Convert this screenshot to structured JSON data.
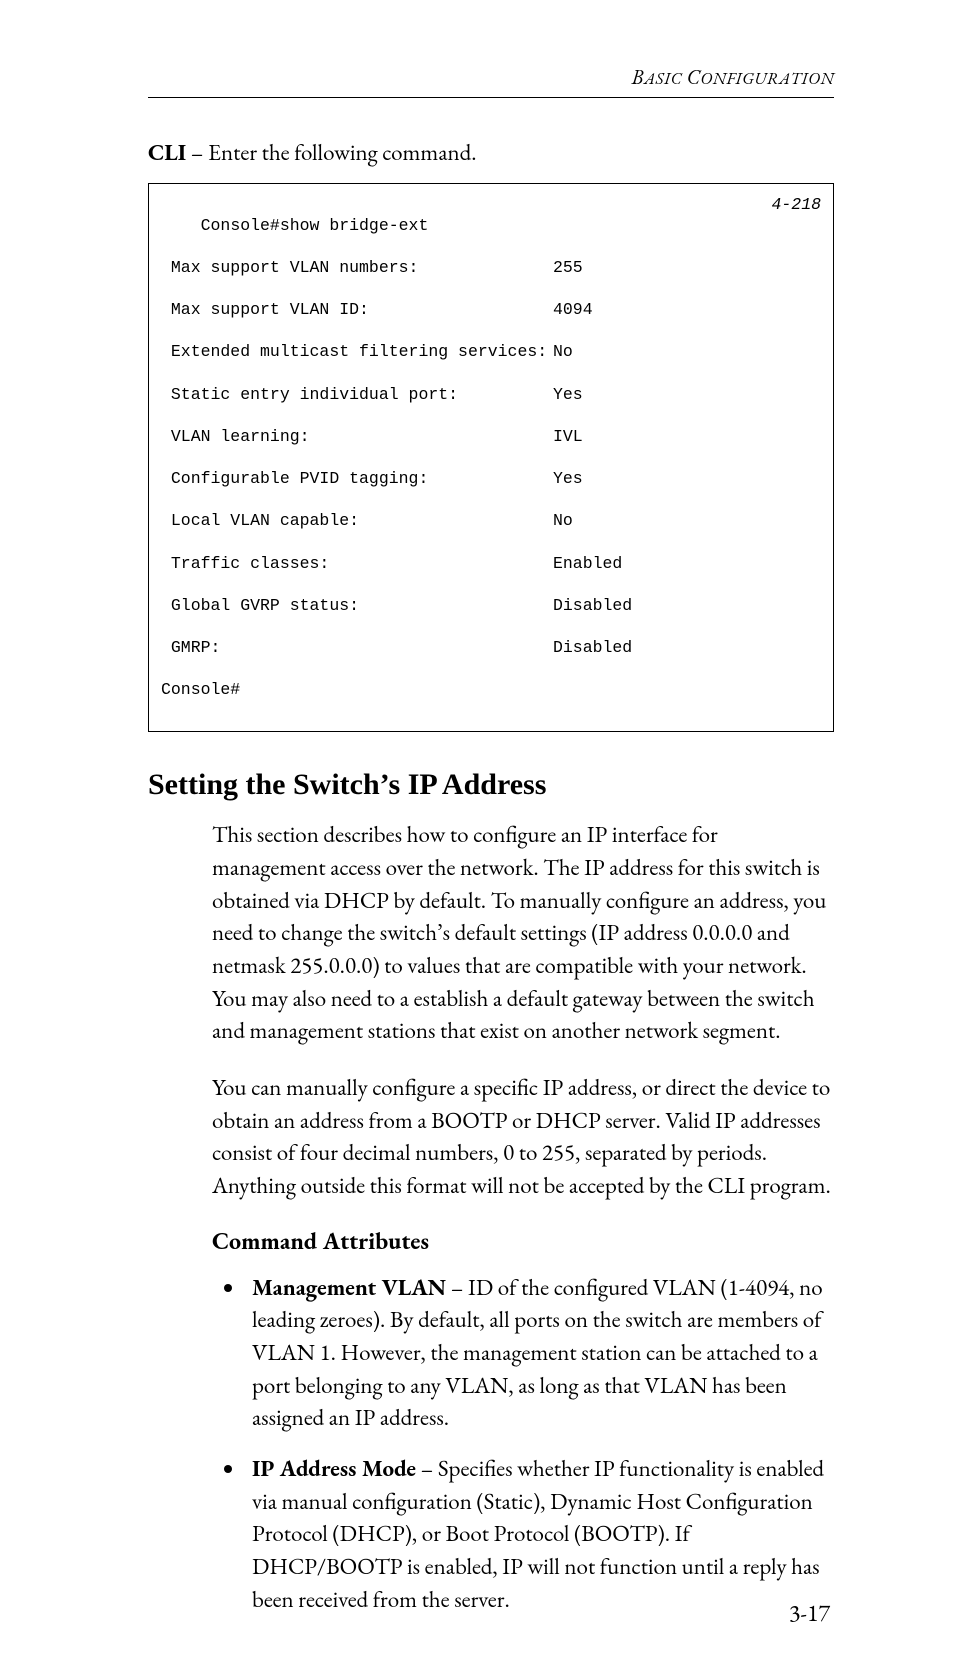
{
  "running_head": "BASIC CONFIGURATION",
  "lead_sentence_prefix": "CLI",
  "lead_sentence_rest": " – Enter the following command.",
  "console": {
    "cmd": "Console#show bridge-ext",
    "ref": "4-218",
    "rows": [
      {
        "k": " Max support VLAN numbers:",
        "v": "255"
      },
      {
        "k": " Max support VLAN ID:",
        "v": "4094"
      },
      {
        "k": " Extended multicast filtering services:",
        "v": "No"
      },
      {
        "k": " Static entry individual port:",
        "v": "Yes"
      },
      {
        "k": " VLAN learning:",
        "v": "IVL"
      },
      {
        "k": " Configurable PVID tagging:",
        "v": "Yes"
      },
      {
        "k": " Local VLAN capable:",
        "v": "No"
      },
      {
        "k": " Traffic classes:",
        "v": "Enabled"
      },
      {
        "k": " Global GVRP status:",
        "v": "Disabled"
      },
      {
        "k": " GMRP:",
        "v": "Disabled"
      }
    ],
    "prompt": "Console#"
  },
  "section_title": "Setting the Switch’s IP Address",
  "para1": "This section describes how to configure an IP interface for management access over the network. The IP address for this switch is obtained via DHCP by default. To manually configure an address, you need to change the switch’s default settings (IP address 0.0.0.0 and netmask 255.0.0.0) to values that are compatible with your network. You may also need to a establish a default gateway between the switch and management stations that exist on another network segment.",
  "para2": "You can manually configure a specific IP address, or direct the device to obtain an address from a BOOTP or DHCP server. Valid IP addresses consist of four decimal numbers, 0 to 255, separated by periods. Anything outside this format will not be accepted by the CLI program.",
  "subhead": "Command Attributes",
  "bullets": [
    {
      "term": "Management VLAN",
      "rest": " – ID of the configured VLAN (1-4094, no leading zeroes). By default, all ports on the switch are members of VLAN 1. However, the management station can be attached to a port belonging to any VLAN, as long as that VLAN has been assigned an IP address."
    },
    {
      "term": "IP Address Mode",
      "rest": " – Specifies whether IP functionality is enabled via manual configuration (Static), Dynamic Host Configuration Protocol (DHCP), or Boot Protocol (BOOTP). If DHCP/BOOTP is enabled, IP will not function until a reply has been received from the server."
    }
  ],
  "page_number": "3-17"
}
